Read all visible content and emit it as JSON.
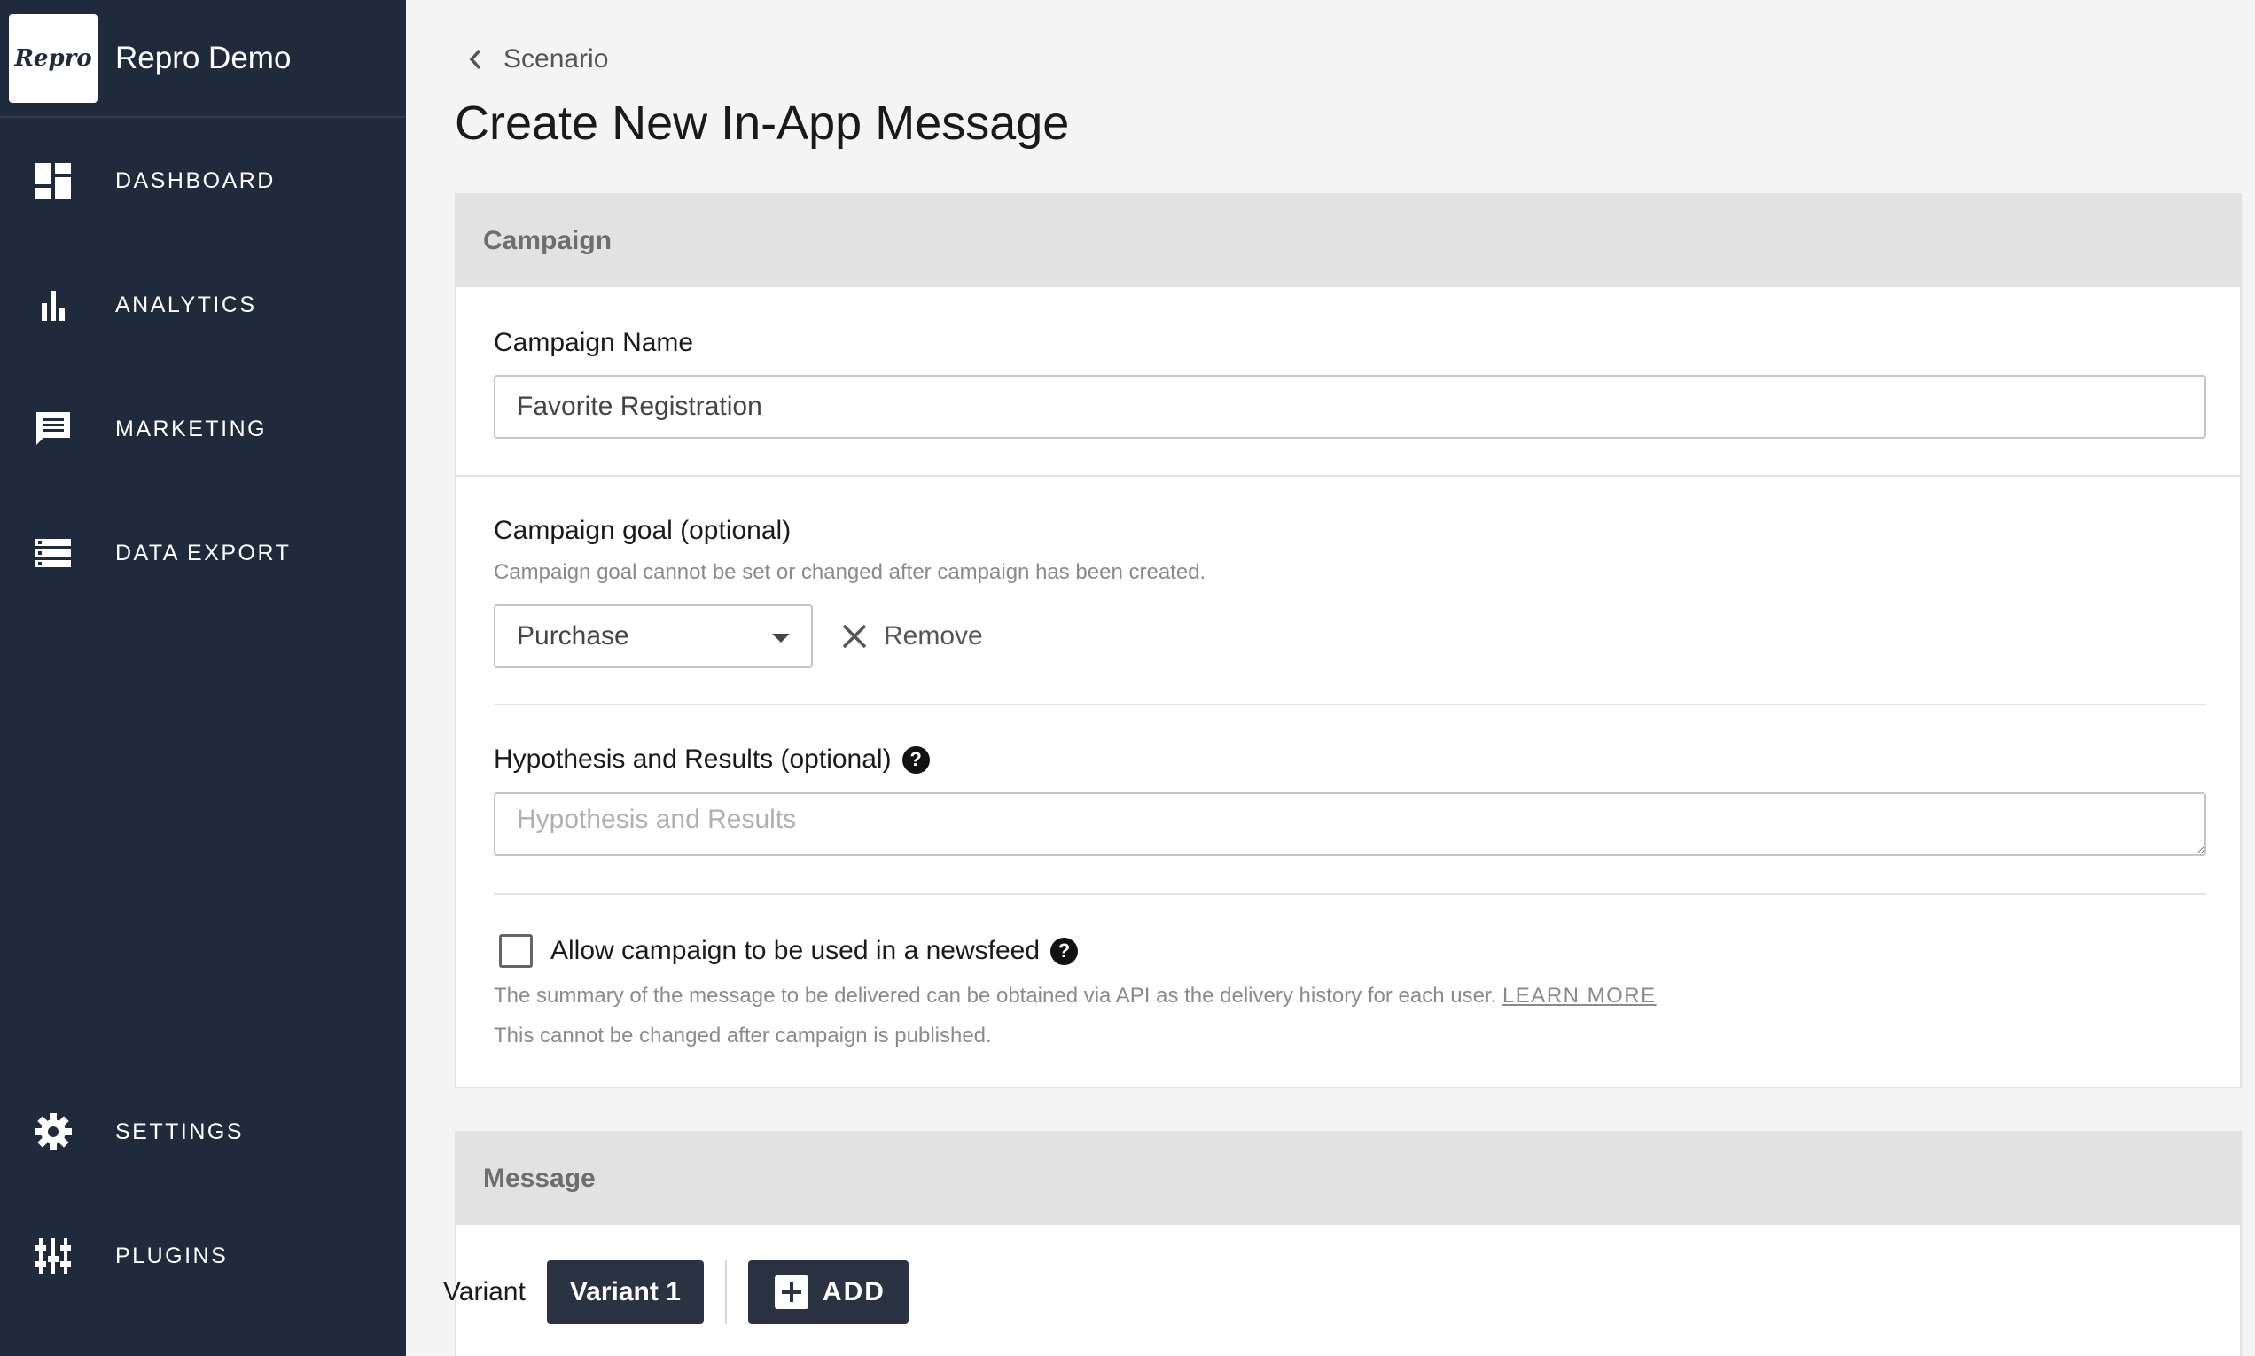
{
  "app": {
    "logo_text": "Repro",
    "name": "Repro Demo"
  },
  "nav": {
    "dashboard": "DASHBOARD",
    "analytics": "ANALYTICS",
    "marketing": "MARKETING",
    "data_export": "DATA EXPORT",
    "settings": "SETTINGS",
    "plugins": "PLUGINS"
  },
  "breadcrumb": {
    "back_label": "Scenario"
  },
  "page": {
    "title": "Create New In-App Message"
  },
  "campaign": {
    "header": "Campaign",
    "name_label": "Campaign Name",
    "name_value": "Favorite Registration",
    "goal_label": "Campaign goal (optional)",
    "goal_help": "Campaign goal cannot be set or changed after campaign has been created.",
    "goal_selected": "Purchase",
    "remove_label": "Remove",
    "hypothesis_label": "Hypothesis and Results (optional)",
    "hypothesis_placeholder": "Hypothesis and Results",
    "newsfeed_label": "Allow campaign to be used in a newsfeed",
    "newsfeed_checked": false,
    "newsfeed_help": "The summary of the message to be delivered can be obtained via API as the delivery history for each user.",
    "learn_more": "LEARN MORE",
    "newsfeed_note": "This cannot be changed after campaign is published."
  },
  "message": {
    "header": "Message",
    "variant_label": "Variant",
    "variant_1": "Variant 1",
    "add_label": "ADD"
  },
  "colors": {
    "sidebar_bg": "#1f2a3d",
    "button_bg": "#2b3342",
    "section_header_bg": "#e2e2e2"
  }
}
